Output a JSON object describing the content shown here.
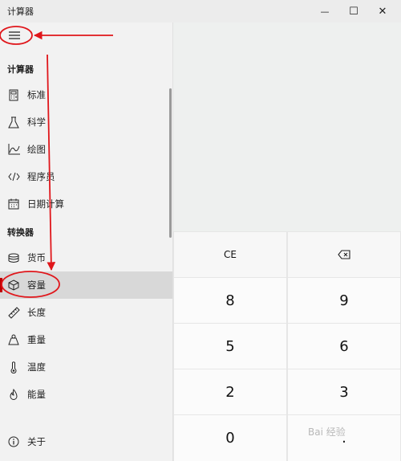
{
  "window": {
    "title": "计算器",
    "minimize_glyph": "—",
    "maximize_glyph": "☐",
    "close_glyph": "✕"
  },
  "nav": {
    "menu_icon": "hamburger-icon",
    "section_calculator": "计算器",
    "calculator_items": [
      {
        "label": "标准",
        "icon": "calculator-icon"
      },
      {
        "label": "科学",
        "icon": "flask-icon"
      },
      {
        "label": "绘图",
        "icon": "graph-icon"
      },
      {
        "label": "程序员",
        "icon": "code-icon"
      },
      {
        "label": "日期计算",
        "icon": "calendar-icon"
      }
    ],
    "section_converter": "转换器",
    "converter_items": [
      {
        "label": "货币",
        "icon": "coins-icon"
      },
      {
        "label": "容量",
        "icon": "cube-icon",
        "selected": true
      },
      {
        "label": "长度",
        "icon": "ruler-icon"
      },
      {
        "label": "重量",
        "icon": "weight-icon"
      },
      {
        "label": "温度",
        "icon": "thermometer-icon"
      },
      {
        "label": "能量",
        "icon": "flame-icon"
      }
    ],
    "about": {
      "label": "关于",
      "icon": "info-icon"
    }
  },
  "keypad": {
    "ce": "CE",
    "backspace_icon": "backspace-icon",
    "rows": [
      [
        "8",
        "9"
      ],
      [
        "5",
        "6"
      ],
      [
        "2",
        "3"
      ],
      [
        "0",
        "."
      ]
    ]
  },
  "watermark": "Bai 经验",
  "colors": {
    "annotation_red": "#e0161b",
    "selection_bar": "#c00000"
  }
}
